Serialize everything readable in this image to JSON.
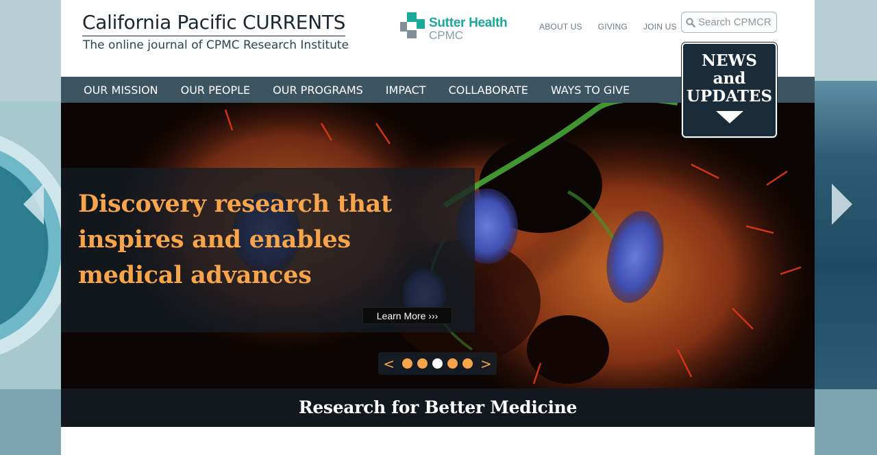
{
  "header": {
    "title": "California Pacific CURRENTS",
    "subtitle": "The online journal of CPMC Research Institute",
    "brand": {
      "name": "Sutter Health",
      "sub": "CPMC",
      "color": "#1aa89a"
    },
    "util_links": [
      "ABOUT US",
      "GIVING",
      "JOIN US"
    ],
    "search_placeholder": "Search CPMCRI"
  },
  "nav": {
    "items": [
      "OUR MISSION",
      "OUR PEOPLE",
      "OUR PROGRAMS",
      "IMPACT",
      "COLLABORATE",
      "WAYS TO GIVE"
    ]
  },
  "news_box": {
    "line1": "NEWS",
    "line2": "and",
    "line3": "UPDATES"
  },
  "hero": {
    "headline": "Discovery research that inspires and enables medical advances",
    "learn_more": "Learn More ›››",
    "pager_prev": "<",
    "pager_next": ">",
    "slide_count": 5,
    "active_slide": 3,
    "accent_color": "#f7a44a"
  },
  "tagline": "Research for Better Medicine",
  "icons": {
    "search": "magnifier-icon",
    "carousel_prev": "chevron-left-icon",
    "carousel_next": "chevron-right-icon",
    "news_arrow": "triangle-down-icon",
    "brand_mark": "sutter-cross-logo"
  }
}
